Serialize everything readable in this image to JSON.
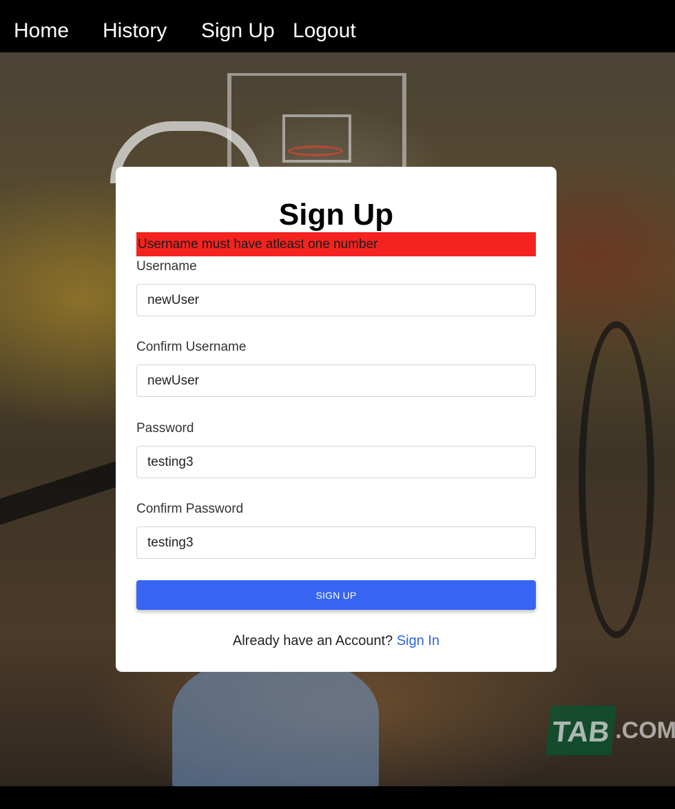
{
  "nav": {
    "items": [
      {
        "label": "Home"
      },
      {
        "label": "History"
      },
      {
        "label": "Sign Up"
      },
      {
        "label": "Logout"
      }
    ]
  },
  "background": {
    "logo_text": "TAB",
    "logo_domain": ".COM.AU"
  },
  "form": {
    "title": "Sign Up",
    "error": "Username must have atleast one number",
    "fields": [
      {
        "label": "Username",
        "value": "newUser"
      },
      {
        "label": "Confirm Username",
        "value": "newUser"
      },
      {
        "label": "Password",
        "value": "testing3"
      },
      {
        "label": "Confirm Password",
        "value": "testing3"
      }
    ],
    "submit_label": "SIGN UP",
    "footer_text": "Already have an Account?",
    "signin_link": "Sign In"
  },
  "colors": {
    "error_bg": "#f4231f",
    "button_bg": "#3764f0",
    "link": "#2c63e8"
  }
}
